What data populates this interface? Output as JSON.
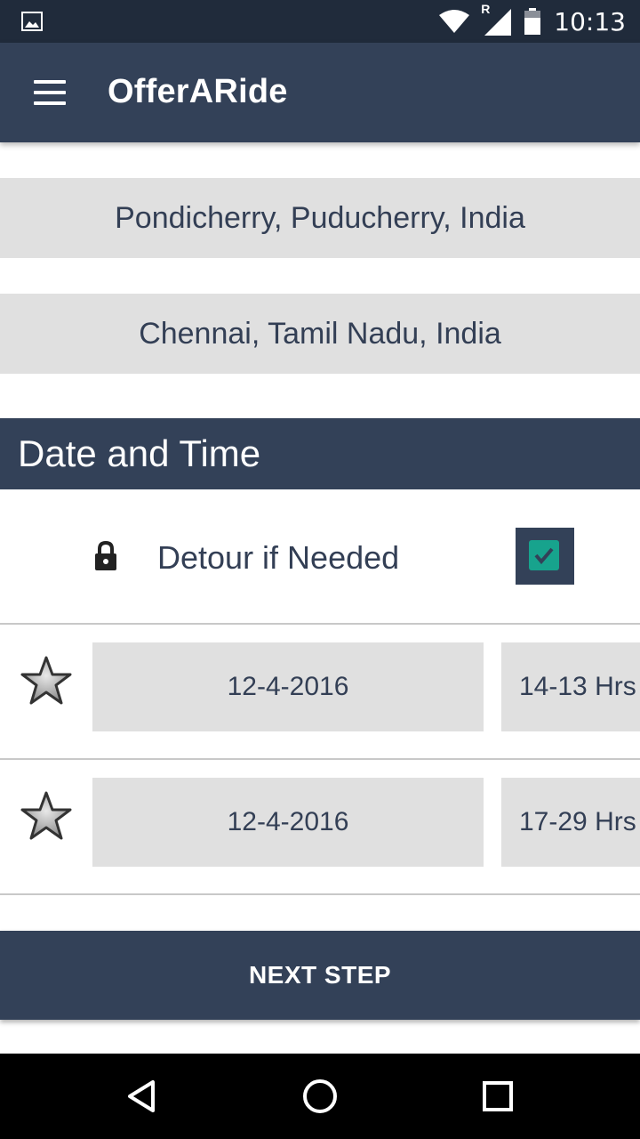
{
  "status_bar": {
    "time": "10:13",
    "roaming_indicator": "R",
    "icons": [
      "image-notification-icon",
      "wifi-icon",
      "signal-icon",
      "battery-icon"
    ]
  },
  "app_bar": {
    "title": "OfferARide",
    "menu_icon": "hamburger-menu-icon"
  },
  "locations": {
    "from": "Pondicherry, Puducherry, India",
    "to": "Chennai, Tamil Nadu, India"
  },
  "date_time_section": {
    "title": "Date and Time",
    "detour": {
      "label": "Detour if Needed",
      "checked": true,
      "icon": "lock-icon"
    },
    "rows": [
      {
        "date": "12-4-2016",
        "time": "14-13 Hrs",
        "icon": "star-icon"
      },
      {
        "date": "12-4-2016",
        "time": "17-29 Hrs",
        "icon": "star-icon"
      }
    ]
  },
  "next_button": {
    "label": "NEXT STEP"
  },
  "nav_bar": {
    "buttons": [
      "back-icon",
      "home-icon",
      "recents-icon"
    ]
  },
  "colors": {
    "status_bar": "#202b3b",
    "primary": "#334158",
    "field_background": "#e0e0e0",
    "text": "#333f55",
    "checkbox_check": "#17a38d"
  }
}
